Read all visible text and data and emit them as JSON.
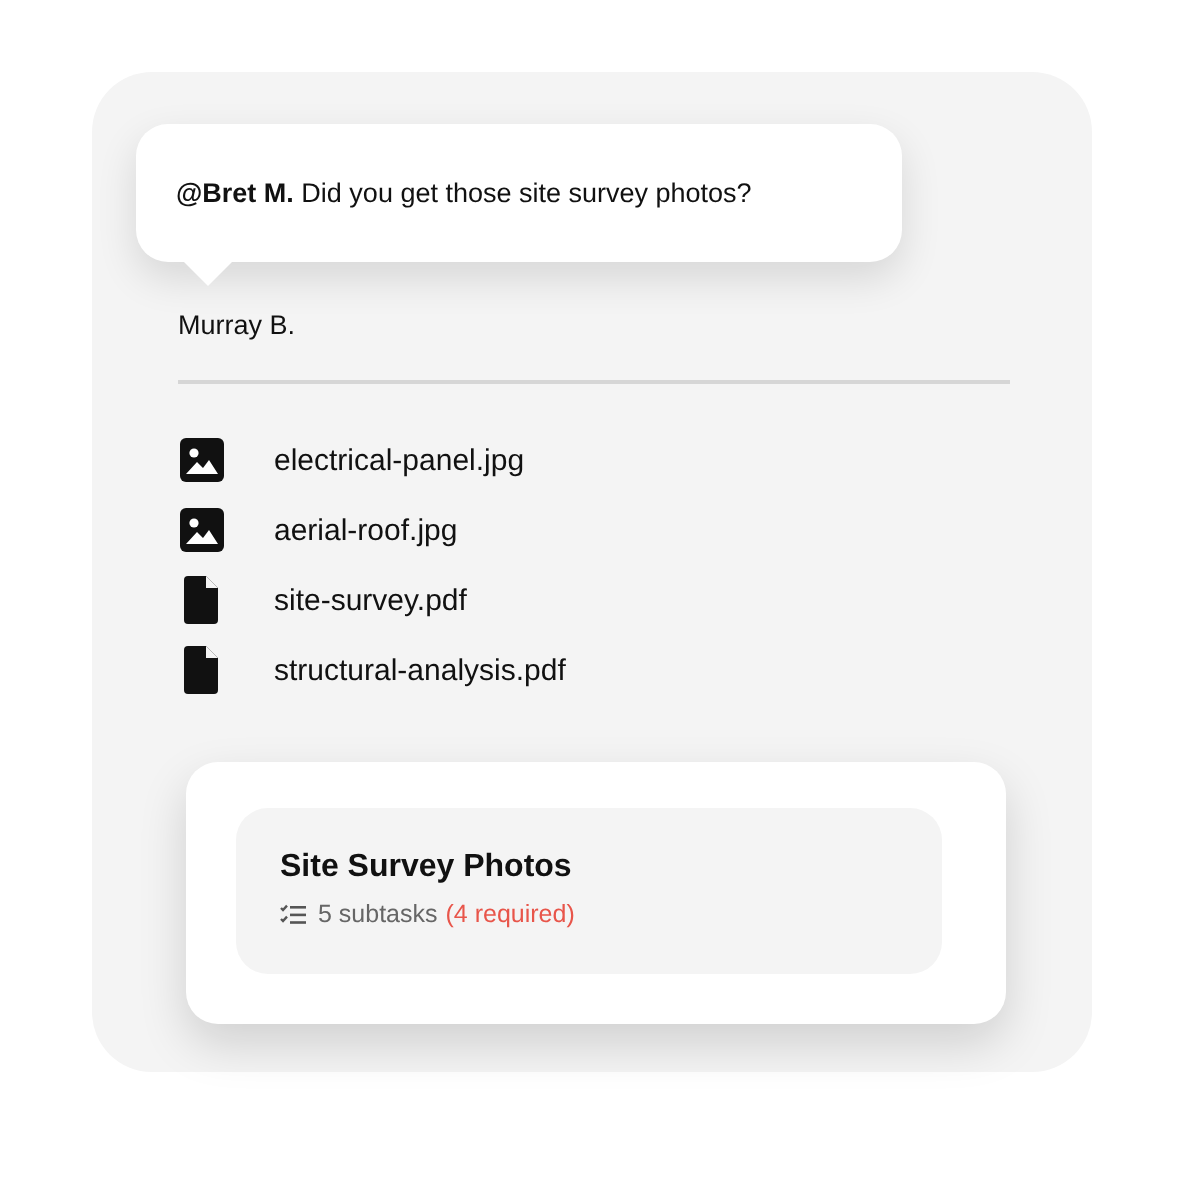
{
  "comment": {
    "message": "**@Bret M.** Did you get those site survey photos?",
    "author": "Murray B."
  },
  "files": [
    {
      "kind": "image",
      "name": "electrical-panel.jpg"
    },
    {
      "kind": "image",
      "name": "aerial-roof.jpg"
    },
    {
      "kind": "pdf",
      "name": "site-survey.pdf"
    },
    {
      "kind": "pdf",
      "name": "structural-analysis.pdf"
    }
  ],
  "task": {
    "title": "Site Survey Photos",
    "subtasks": "5 subtasks",
    "required": "(4 required)"
  }
}
